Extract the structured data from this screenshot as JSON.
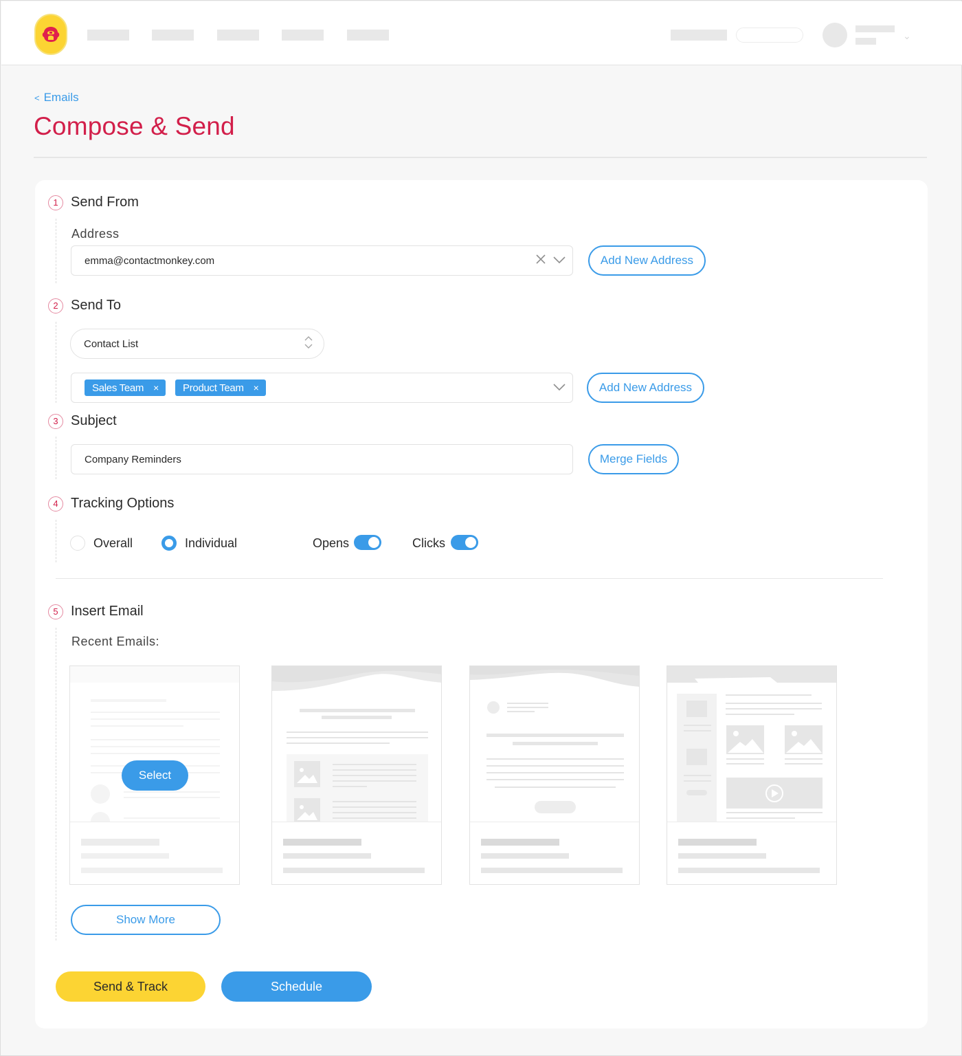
{
  "brand": {
    "logo": "monkey-logo-icon",
    "accent": "#3a9be8",
    "title_color": "#d21f4a",
    "logo_color": "#fcd433",
    "primary_action_color": "#fcd433"
  },
  "breadcrumb": {
    "icon": "chevron-left-icon",
    "label": "Emails",
    "prefix": "<"
  },
  "page_title": "Compose & Send",
  "steps": {
    "send_from": {
      "number": "1",
      "title": "Send From",
      "address_label": "Address",
      "address_value": "emma@contactmonkey.com",
      "clear_icon": "close-icon",
      "dropdown_icon": "chevron-down-icon",
      "add_button": "Add New Address"
    },
    "send_to": {
      "number": "2",
      "title": "Send To",
      "list_type": "Contact List",
      "list_type_icon": "sort-updown-icon",
      "recipients": [
        {
          "label": "Sales Team",
          "remove": "×"
        },
        {
          "label": "Product Team",
          "remove": "×"
        }
      ],
      "dropdown_icon": "chevron-down-icon",
      "add_button": "Add New Address"
    },
    "subject": {
      "number": "3",
      "title": "Subject",
      "value": "Company Reminders",
      "merge_button": "Merge Fields"
    },
    "tracking": {
      "number": "4",
      "title": "Tracking Options",
      "modes": [
        {
          "label": "Overall",
          "selected": false
        },
        {
          "label": "Individual",
          "selected": true
        }
      ],
      "toggles": [
        {
          "label": "Opens",
          "on": true
        },
        {
          "label": "Clicks",
          "on": true
        }
      ]
    },
    "insert_email": {
      "number": "5",
      "title": "Insert Email",
      "recent_label": "Recent Emails:",
      "select_button": "Select",
      "thumbnails": [
        {
          "kind": "plain-text-template",
          "hovered": true
        },
        {
          "kind": "newsletter-with-images-template",
          "hovered": false
        },
        {
          "kind": "announcement-with-button-template",
          "hovered": false
        },
        {
          "kind": "multi-column-video-template",
          "hovered": false
        }
      ],
      "show_more": "Show More"
    }
  },
  "actions": {
    "send_track": "Send & Track",
    "schedule": "Schedule"
  }
}
